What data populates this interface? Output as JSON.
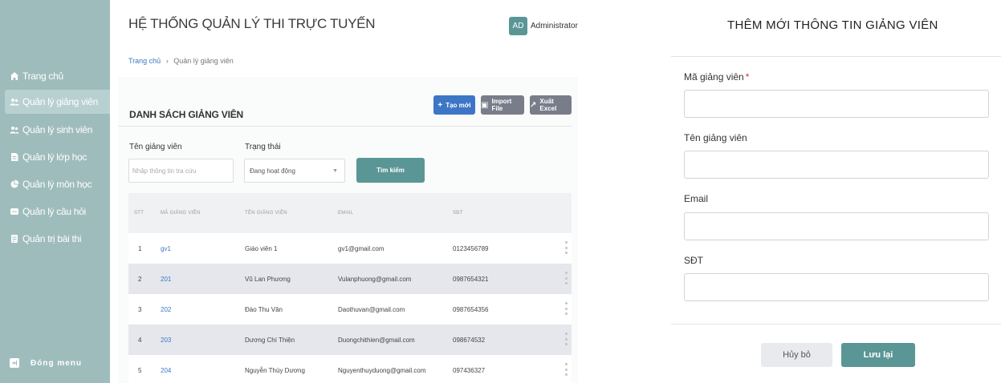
{
  "app": {
    "title": "HỆ THỐNG QUẢN LÝ THI TRỰC TUYẾN",
    "user": {
      "avatar_initials": "AD",
      "name": "Administrator"
    }
  },
  "sidebar": {
    "items": [
      {
        "label": "Trang chủ",
        "icon": "home-icon",
        "active": false
      },
      {
        "label": "Quản lý giảng viên",
        "icon": "users-icon",
        "active": true
      },
      {
        "label": "Quản lý sinh viên",
        "icon": "users-icon",
        "active": false
      },
      {
        "label": "Quản lý lớp học",
        "icon": "document-icon",
        "active": false
      },
      {
        "label": "Quản lý môn học",
        "icon": "pie-icon",
        "active": false
      },
      {
        "label": "Quản lý câu hỏi",
        "icon": "chat-icon",
        "active": false
      },
      {
        "label": "Quản trị bài thi",
        "icon": "file-icon",
        "active": false
      }
    ],
    "close_menu_label": "Đóng menu"
  },
  "breadcrumb": {
    "home": "Trang chủ",
    "separator": "›",
    "current": "Quản lý giảng viên"
  },
  "list": {
    "title": "DANH SÁCH GIẢNG VIÊN",
    "buttons": {
      "create": "Tạo mới",
      "import": "Import File",
      "export": "Xuất Excel"
    }
  },
  "filters": {
    "name_label": "Tên giảng viên",
    "name_placeholder": "Nhập thông tin tra cứu",
    "status_label": "Trạng thái",
    "status_value": "Đang hoạt động",
    "search_button": "Tìm kiếm"
  },
  "table": {
    "headers": [
      "STT",
      "MÃ GIẢNG VIÊN",
      "TÊN GIẢNG VIÊN",
      "EMAIL",
      "SĐT"
    ],
    "rows": [
      {
        "stt": "1",
        "code": "gv1",
        "name": "Giáo viên 1",
        "email": "gv1@gmail.com",
        "phone": "0123456789"
      },
      {
        "stt": "2",
        "code": "201",
        "name": "Vũ Lan Phương",
        "email": "Vulanphuong@gmail.com",
        "phone": "0987654321"
      },
      {
        "stt": "3",
        "code": "202",
        "name": "Đào Thu Vân",
        "email": "Daothuvan@gmail.com",
        "phone": "0987654356"
      },
      {
        "stt": "4",
        "code": "203",
        "name": "Dương Chí Thiện",
        "email": "Duongchithien@gmail.com",
        "phone": "098674532"
      },
      {
        "stt": "5",
        "code": "204",
        "name": "Nguyễn Thùy Dương",
        "email": "Nguyenthuyduong@gmail.com",
        "phone": "097436327"
      }
    ]
  },
  "modal": {
    "title": "THÊM MỚI THÔNG TIN GIẢNG VIÊN",
    "fields": [
      {
        "label": "Mã giảng viên",
        "required": "*",
        "value": ""
      },
      {
        "label": "Tên giảng viên",
        "value": ""
      },
      {
        "label": "Email",
        "value": ""
      },
      {
        "label": "SĐT",
        "value": ""
      }
    ],
    "cancel_label": "Hủy bỏ",
    "save_label": "Lưu lại"
  },
  "colors": {
    "sidebar_bg": "#9fbcbd",
    "sidebar_active": "#b9d0d1",
    "primary_teal": "#5b9696",
    "primary_blue": "#3d76c6",
    "secondary_gray": "#797d8a"
  }
}
